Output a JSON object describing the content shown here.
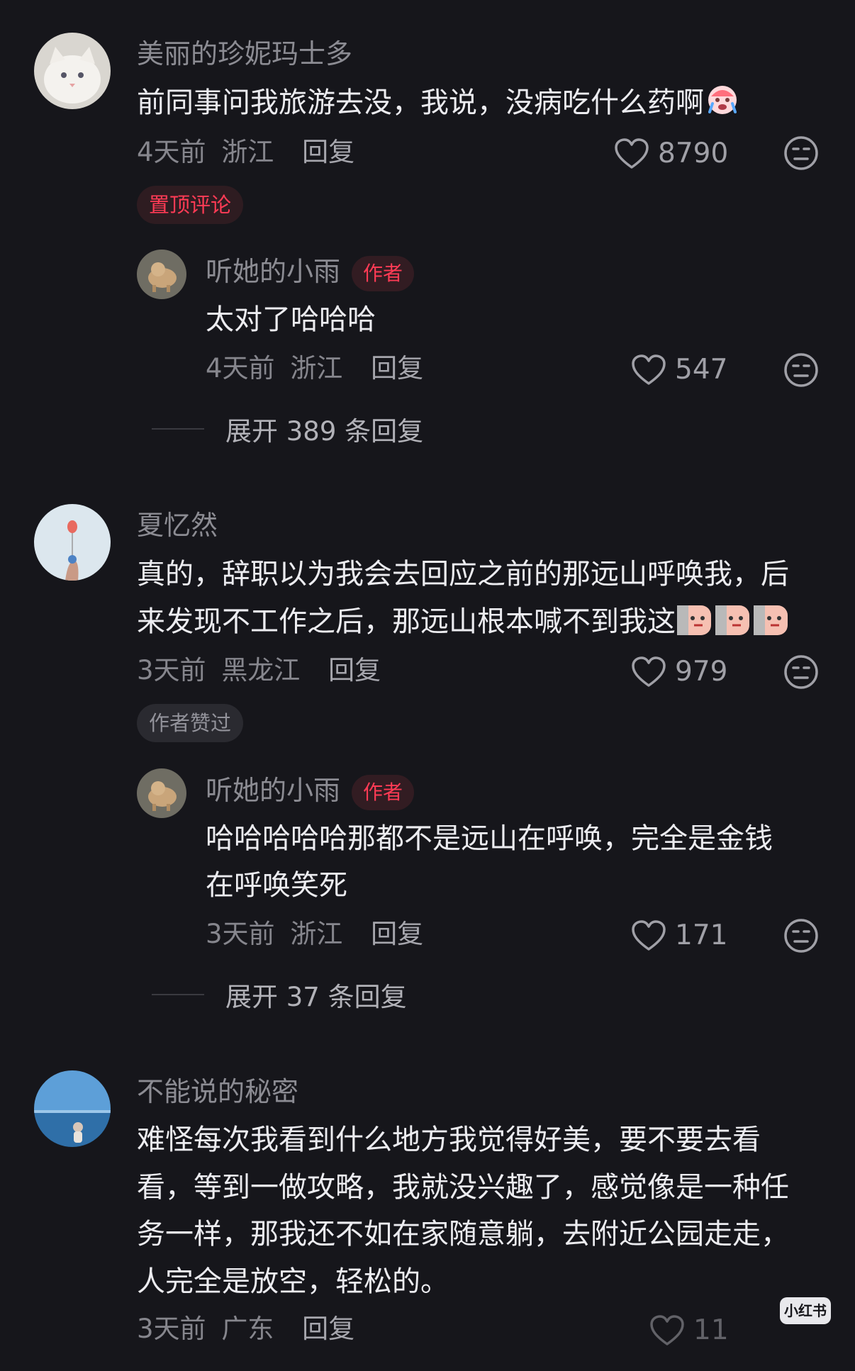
{
  "colors": {
    "background": "#16161b",
    "accent_red": "#ff3b55",
    "text_primary": "#ececf0",
    "text_secondary": "#86868d"
  },
  "comments": [
    {
      "username": "美丽的珍妮玛士多",
      "text": "前同事问我旅游去没，我说，没病吃什么药啊",
      "emoji": "crying-face-icon",
      "time": "4天前",
      "location": "浙江",
      "reply_label": "回复",
      "likes": "8790",
      "tag": "置顶评论",
      "reply": {
        "username": "听她的小雨",
        "badge": "作者",
        "text": "太对了哈哈哈",
        "time": "4天前",
        "location": "浙江",
        "reply_label": "回复",
        "likes": "547"
      },
      "expand_label": "展开 389 条回复"
    },
    {
      "username": "夏忆然",
      "text_line1": "真的，辞职以为我会去回应之前的那远山呼唤我，后",
      "text_line2": "来发现不工作之后，那远山根本喊不到我这",
      "emoji": "sly-face-icon",
      "time": "3天前",
      "location": "黑龙江",
      "reply_label": "回复",
      "likes": "979",
      "tag": "作者赞过",
      "reply": {
        "username": "听她的小雨",
        "badge": "作者",
        "text_line1": "哈哈哈哈哈那都不是远山在呼唤，完全是金钱",
        "text_line2": "在呼唤笑死",
        "time": "3天前",
        "location": "浙江",
        "reply_label": "回复",
        "likes": "171"
      },
      "expand_label": "展开 37 条回复"
    },
    {
      "username": "不能说的秘密",
      "text_lines": [
        "难怪每次我看到什么地方我觉得好美，要不要去看",
        "看，等到一做攻略，我就没兴趣了，感觉像是一种任",
        "务一样，那我还不如在家随意躺，去附近公园走走，",
        "人完全是放空，轻松的。"
      ],
      "time": "3天前",
      "location": "广东",
      "reply_label": "回复",
      "likes": "11"
    }
  ],
  "watermark": "小红书"
}
